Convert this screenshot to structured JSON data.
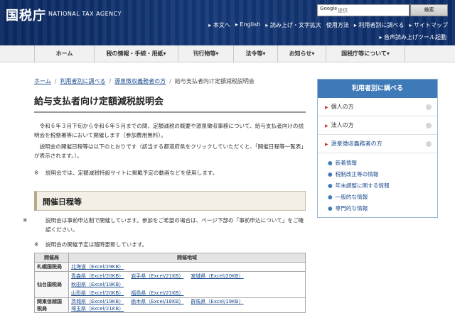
{
  "header": {
    "logo": "国税庁",
    "logo_en": "NATIONAL TAX AGENCY",
    "search_brand": "Google",
    "search_placeholder": "提供",
    "search_button": "検索",
    "util_links": [
      "▸ 本文へ",
      "▸ English",
      "▸ 読み上げ・文字拡大",
      "使用方法",
      "▸ 利用者別に調べる",
      "▸ サイトマップ"
    ],
    "util_link_2": "▸ 音声読み上げツール起動"
  },
  "gnav": [
    "ホーム",
    "税の情報・手続・用紙▾",
    "刊行物等▾",
    "法令等▾",
    "お知らせ▾",
    "国税庁等について▾"
  ],
  "breadcrumb": {
    "home": "ホーム",
    "by_user": "利用者別に調べる",
    "withholding": "源泉徴収義務者の方",
    "current": "給与支払者向け定額減税説明会"
  },
  "page": {
    "title": "給与支払者向け定額減税説明会",
    "para1": "令和６年３月下旬から令和６年５月までの間、定額減税の概要や源泉徴収事務について、給与支払者向けの説明会を税務署等において開催します（参加費用無料）。",
    "para2": "説明会の開催日程等は以下のとおりです（該当する都道府県をクリックしていただくと、「開催日程等一覧表」が表示されます。）。",
    "note1": "説明会では、定額減税特設サイトに掲載予定の動画などを使用します。",
    "section_title": "開催日程等",
    "note2": "説明会は事前申込制で開催しています。参加をご希望の場合は、ページ下部の「事前申込について」をご確認ください。",
    "note3": "説明会の開催予定は随時更新しています。",
    "note_mark": "※"
  },
  "table": {
    "headers": [
      "開催局",
      "開催地域"
    ],
    "rows": [
      {
        "bureau": "札幌国税局",
        "links": [
          "北海道（Excel/29KB）"
        ]
      },
      {
        "bureau": "仙台国税局",
        "links": [
          "青森県（Excel/20KB）",
          "岩手県（Excel/21KB）",
          "宮城県（Excel/20KB）",
          "秋田県（Excel/19KB）"
        ],
        "links2": [
          "山形県（Excel/20KB）",
          "福島県（Excel/21KB）"
        ]
      },
      {
        "bureau": "関東信越国税局",
        "links": [
          "茨城県（Excel/19KB）",
          "栃木県（Excel/18KB）",
          "群馬県（Excel/19KB）",
          "埼玉県（Excel/21KB）"
        ]
      }
    ]
  },
  "sidebar": {
    "title": "利用者別に調べる",
    "items": [
      "個人の方",
      "法人の方",
      "源泉徴収義務者の方"
    ],
    "sub_items": [
      "新着情報",
      "税制改正等の情報",
      "年末調整に関する情報",
      "一般的な情報",
      "専門的な情報"
    ]
  }
}
